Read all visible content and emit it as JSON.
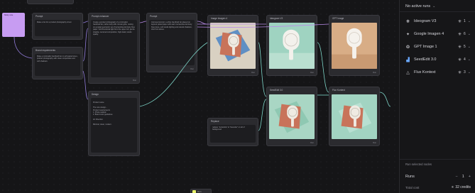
{
  "canvas": {
    "sticky_note": "Sticky note",
    "nodes": {
      "prompt": {
        "title": "Prompt",
        "text": "Make a fan for a product photography shoot",
        "foot": ""
      },
      "brand_requirements": {
        "title": "Brand requirements",
        "text": "Make a minimalist handheld fan in soft pastel tones, product photography with clean composition and soft shadows.",
        "foot": ""
      },
      "prompt_enhancer": {
        "title": "Prompt enhancer",
        "text": "Create a product photograph of a minimalist handheld fan, white body with circular grille, resting on a pastel geometric set of terracotta and dusty blue paper. Soft directional light from the upper left, gentle shadow, centered composition, high detail, studio quality.",
        "foot": "Run"
      },
      "design": {
        "title": "Design",
        "text": "Product name\n\nThe core design...\nProduct requirements\n1. Photo-realistic\n2. Brand color guidelines\n\nArt Direction\n\nMinimal, clean, modern.",
        "foot": ""
      },
      "enhance": {
        "title": "Prompt",
        "text": "Improved prompt: a white handheld fan placed on layered pastel paper with warm terracotta and dusty blue tones, soft studio lighting and natural shadows, shot from above.",
        "foot": "Run"
      },
      "replace": {
        "title": "Replace",
        "text": "replace \"terracotta\" to \"lavender\" on all of background",
        "foot": ""
      },
      "img_a": {
        "title": "Image Imagen 4",
        "foot": "Run"
      },
      "img_b": {
        "title": "Ideogram V3",
        "foot": "Run"
      },
      "img_c": {
        "title": "GPT Image",
        "foot": "Run"
      },
      "img_d": {
        "title": "SeedEdit 3.0",
        "foot": "Run"
      },
      "img_e": {
        "title": "Flux Kontext",
        "foot": "Run"
      }
    },
    "bottom_chip": "Run"
  },
  "panel": {
    "runs_label": "No active runs",
    "models": [
      {
        "name": "Ideogram V3",
        "icon": "ideogram-icon",
        "count": "1"
      },
      {
        "name": "Google Imagen 4",
        "icon": "google-imagen-icon",
        "count": "6"
      },
      {
        "name": "GPT Image 1",
        "icon": "gpt-icon",
        "count": "5"
      },
      {
        "name": "SeedEdit 3.0",
        "icon": "seededit-icon",
        "count": "4"
      },
      {
        "name": "Flux Kontext",
        "icon": "flux-icon",
        "count": "3"
      }
    ],
    "run_selected": "Run selected nodes",
    "runs_title": "Runs",
    "runs_value": "1",
    "total_label": "Total cost",
    "total_value": "32 credits"
  },
  "colors": {
    "accent_purple": "#c79cf2",
    "terracotta": "#c8735a",
    "dusty_blue": "#5f8fc4",
    "mint_bg": "#9fd3c1",
    "sand_bg": "#d8ad86"
  }
}
